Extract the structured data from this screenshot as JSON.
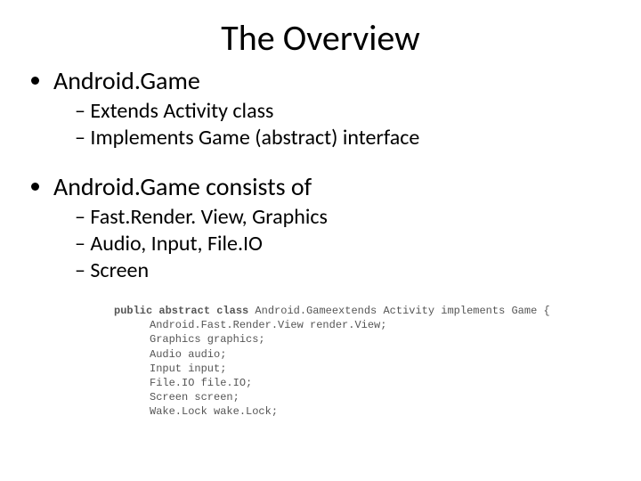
{
  "title": "The Overview",
  "bullets": [
    {
      "text": "Android.Game",
      "children": [
        "Extends Activity class",
        "Implements Game (abstract) interface"
      ]
    },
    {
      "text": "Android.Game consists of",
      "children": [
        "Fast.Render. View, Graphics",
        "Audio, Input, File.IO",
        "Screen"
      ]
    }
  ],
  "code": {
    "decl_keywords": "public abstract class",
    "decl_rest": " Android.Gameextends Activity implements Game {",
    "lines": [
      "Android.Fast.Render.View render.View;",
      "Graphics graphics;",
      "Audio audio;",
      "Input input;",
      "File.IO file.IO;",
      "Screen screen;",
      "Wake.Lock wake.Lock;"
    ]
  }
}
